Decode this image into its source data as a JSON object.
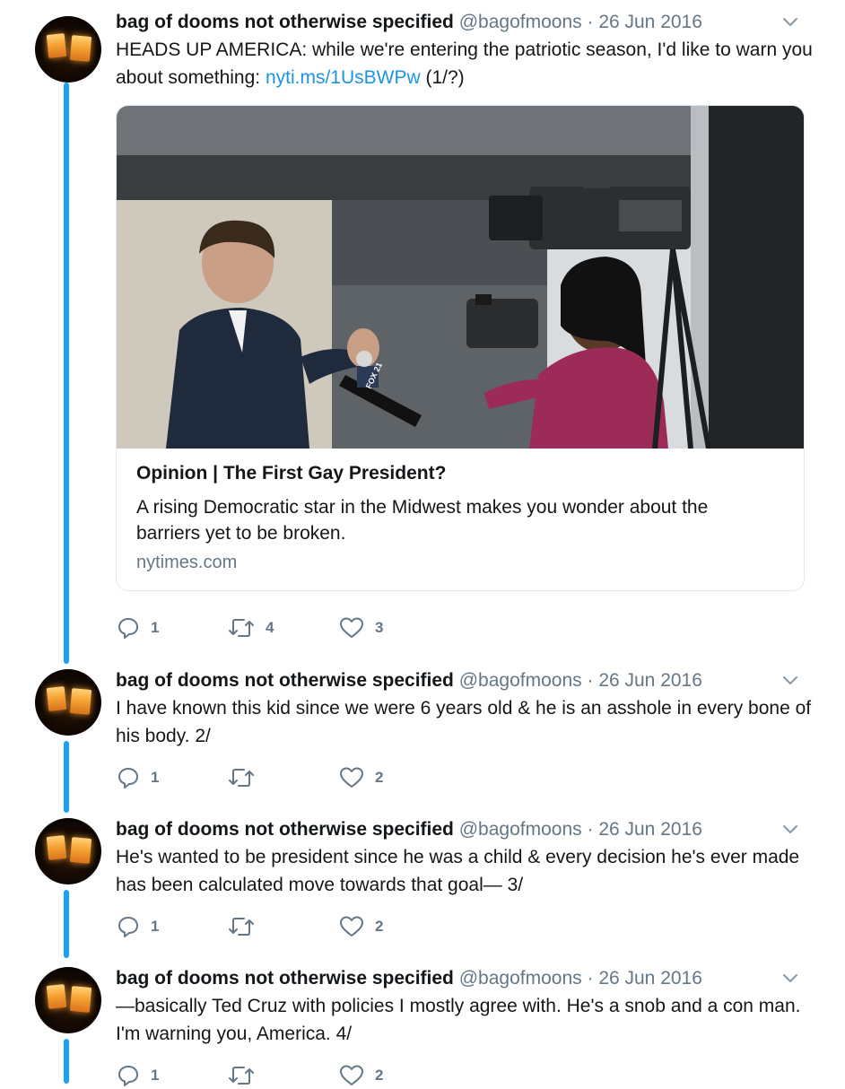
{
  "tweets": [
    {
      "name": "bag of dooms not otherwise specified",
      "handle": "@bagofmoons",
      "separator": "·",
      "date": "26 Jun 2016",
      "text_before_link": "HEADS UP AMERICA: while we're entering the patriotic season, I'd like to warn you about something: ",
      "link": "nyti.ms/1UsBWPw",
      "text_after_link": " (1/?)",
      "card": {
        "title": "Opinion | The First Gay President?",
        "description": "A rising Democratic star in the Midwest makes you wonder about the barriers yet to be broken.",
        "domain": "nytimes.com",
        "mic_label": "FOX 21"
      },
      "replies": "1",
      "retweets": "4",
      "likes": "3"
    },
    {
      "name": "bag of dooms not otherwise specified",
      "handle": "@bagofmoons",
      "separator": "·",
      "date": "26 Jun 2016",
      "text": "I have known this kid since we were 6 years old & he is an asshole in every bone of his body. 2/",
      "replies": "1",
      "retweets": "",
      "likes": "2"
    },
    {
      "name": "bag of dooms not otherwise specified",
      "handle": "@bagofmoons",
      "separator": "·",
      "date": "26 Jun 2016",
      "text": "He's wanted to be president since he was a child & every decision he's ever made has been calculated move towards that goal— 3/",
      "replies": "1",
      "retweets": "",
      "likes": "2"
    },
    {
      "name": "bag of dooms not otherwise specified",
      "handle": "@bagofmoons",
      "separator": "·",
      "date": "26 Jun 2016",
      "text": "—basically Ted Cruz with policies I mostly agree with. He's a snob and a con man. I'm warning you, America. 4/",
      "replies": "1",
      "retweets": "",
      "likes": "2"
    }
  ],
  "colors": {
    "thread_line": "#1da1f2",
    "link": "#1b95e0",
    "secondary_text": "#657786",
    "primary_text": "#14171a"
  },
  "icons": {
    "reply": "reply-icon",
    "retweet": "retweet-icon",
    "like": "heart-icon",
    "menu": "chevron-down-icon"
  }
}
